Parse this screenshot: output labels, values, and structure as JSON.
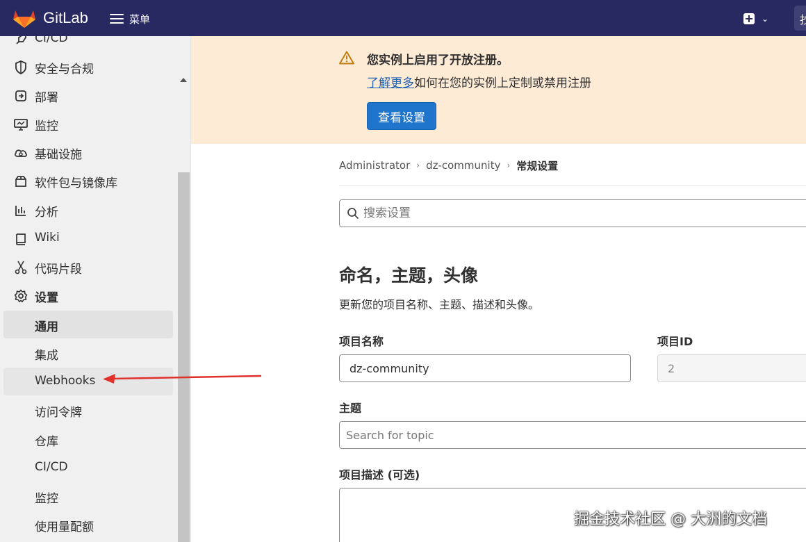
{
  "topbar": {
    "brand": "GitLab",
    "menu_label": "菜单",
    "search_edge": "抄"
  },
  "sidebar": {
    "items": [
      {
        "label": "CI/CD",
        "icon": "rocket-icon"
      },
      {
        "label": "安全与合规",
        "icon": "shield-icon"
      },
      {
        "label": "部署",
        "icon": "deploy-icon"
      },
      {
        "label": "监控",
        "icon": "monitor-icon"
      },
      {
        "label": "基础设施",
        "icon": "cloud-gear-icon"
      },
      {
        "label": "软件包与镜像库",
        "icon": "package-icon"
      },
      {
        "label": "分析",
        "icon": "chart-icon"
      },
      {
        "label": "Wiki",
        "icon": "book-icon"
      },
      {
        "label": "代码片段",
        "icon": "scissors-icon"
      },
      {
        "label": "设置",
        "icon": "gear-icon"
      }
    ],
    "sub_items": [
      {
        "label": "通用",
        "active": true
      },
      {
        "label": "集成"
      },
      {
        "label": "Webhooks"
      },
      {
        "label": "访问令牌"
      },
      {
        "label": "仓库"
      },
      {
        "label": "CI/CD"
      },
      {
        "label": "监控"
      },
      {
        "label": "使用量配额"
      }
    ]
  },
  "banner": {
    "title": "您实例上启用了开放注册。",
    "link": "了解更多",
    "text": "如何在您的实例上定制或禁用注册",
    "button": "查看设置",
    "warn_color": "#c17d10"
  },
  "breadcrumb": {
    "items": [
      "Administrator",
      "dz-community",
      "常规设置"
    ]
  },
  "search": {
    "placeholder": "搜索设置"
  },
  "section": {
    "title": "命名，主题，头像",
    "description": "更新您的项目名称、主题、描述和头像。",
    "project_name_label": "项目名称",
    "project_name_value": "dz-community",
    "project_id_label": "项目ID",
    "project_id_value": "2",
    "topic_label": "主题",
    "topic_placeholder": "Search for topic",
    "description_label": "项目描述 (可选)"
  },
  "watermark": "掘金技术社区 @ 大洲的文档",
  "colors": {
    "topbar": "#292961",
    "sidebar": "#f0f0f0",
    "banner": "#fdebd6",
    "primary": "#1f75cb",
    "arrow": "#e0312b"
  }
}
